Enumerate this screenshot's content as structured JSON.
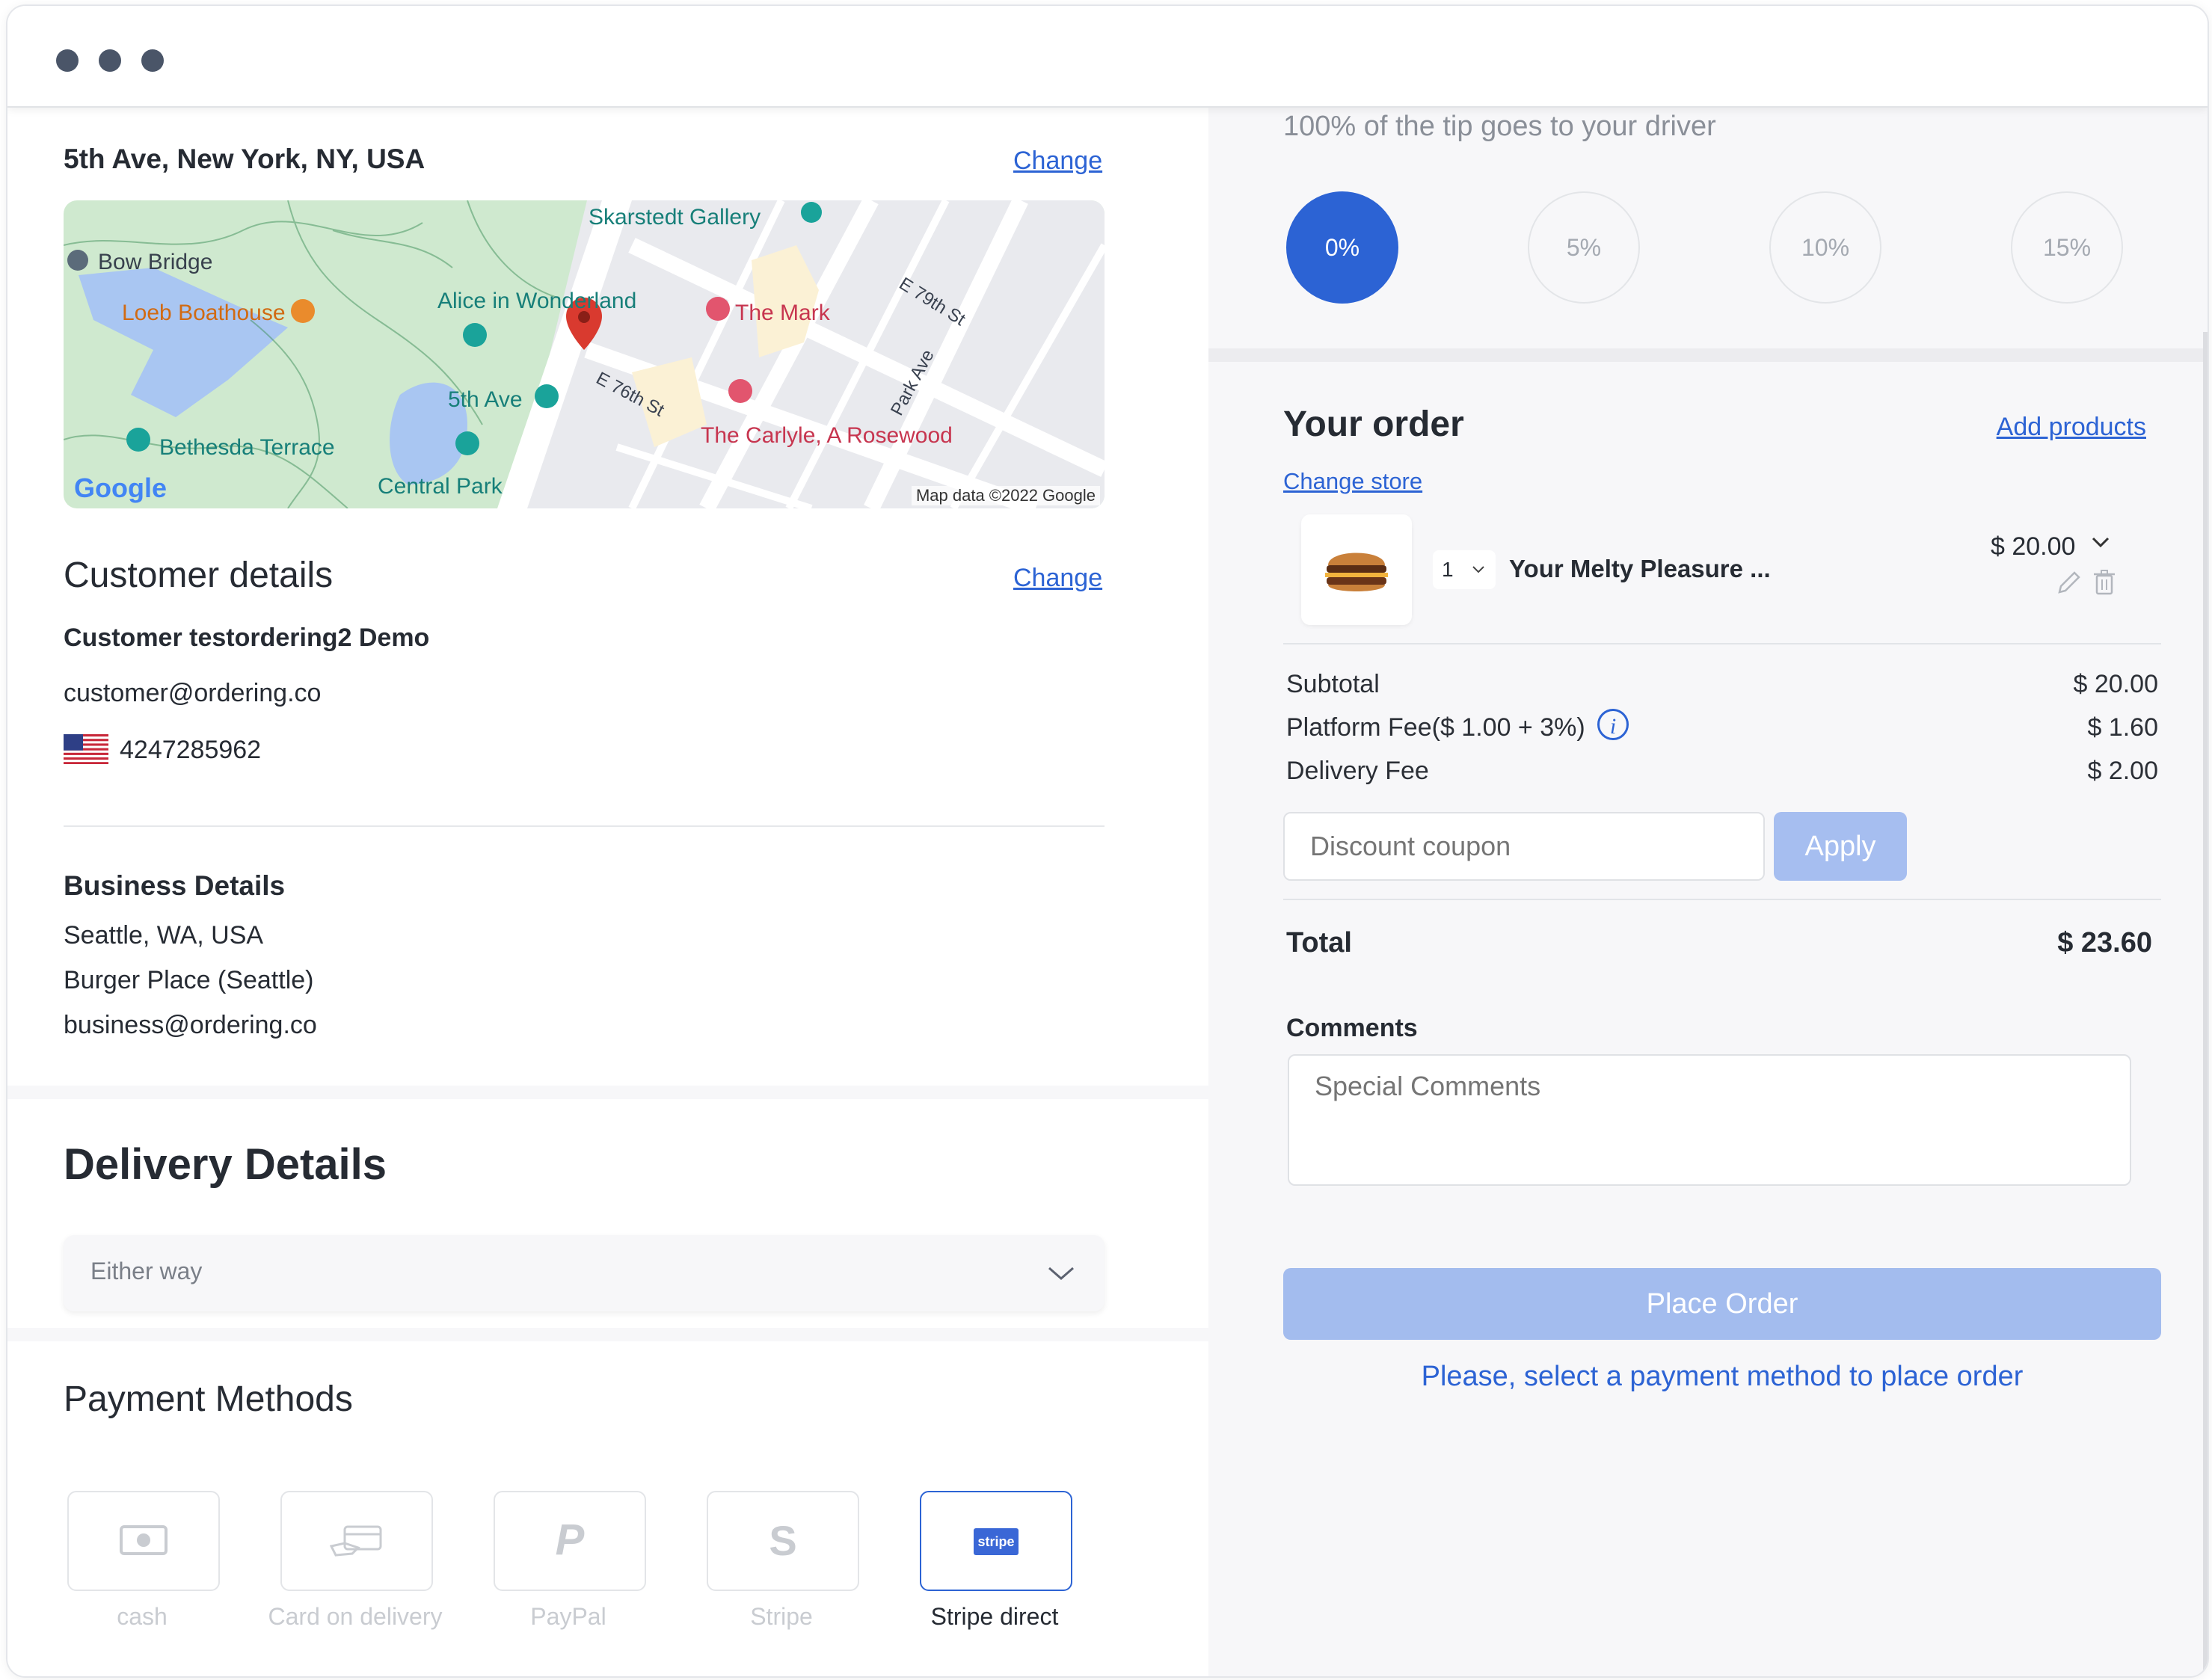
{
  "colors": {
    "accent": "#2c63d4",
    "tip_active": "#2c63d4",
    "apply_button": "#a6bef0",
    "place_order_button": "#a3bcee",
    "map_pin": "#d93a2f"
  },
  "address": {
    "title": "5th Ave, New York, NY, USA",
    "change_label": "Change"
  },
  "map": {
    "attribution": "Map data ©2022 Google",
    "logo": "Google",
    "labels": {
      "bow_bridge": "Bow Bridge",
      "loeb": "Loeb Boathouse",
      "alice": "Alice in Wonderland",
      "skarstedt": "Skarstedt Gallery",
      "the_mark": "The Mark",
      "e79": "E 79th St",
      "park_ave": "Park Ave",
      "e76": "E 76th St",
      "fifth_ave": "5th Ave",
      "bethesda": "Bethesda Terrace",
      "carlyle": "The Carlyle, A Rosewood",
      "central_park": "Central Park"
    }
  },
  "customer": {
    "heading": "Customer details",
    "change_label": "Change",
    "name": "Customer testordering2 Demo",
    "email": "customer@ordering.co",
    "phone": "4247285962"
  },
  "business": {
    "heading": "Business Details",
    "address": "Seattle, WA, USA",
    "name": "Burger Place (Seattle)",
    "email": "business@ordering.co"
  },
  "delivery": {
    "heading": "Delivery Details",
    "selected_option": "Either way"
  },
  "payment": {
    "heading": "Payment Methods",
    "methods": [
      {
        "label": "cash",
        "icon": "cash-icon"
      },
      {
        "label": "Card on delivery",
        "icon": "card-delivery-icon"
      },
      {
        "label": "PayPal",
        "icon": "paypal-icon"
      },
      {
        "label": "Stripe",
        "icon": "stripe-s-icon"
      },
      {
        "label": "Stripe direct",
        "icon": "stripe-logo-icon",
        "badge": "stripe"
      }
    ]
  },
  "tip": {
    "note": "100% of the tip goes to your driver",
    "options": [
      "0%",
      "5%",
      "10%",
      "15%"
    ],
    "selected": "0%"
  },
  "order": {
    "heading": "Your order",
    "add_products": "Add products",
    "change_store": "Change store",
    "item": {
      "quantity": "1",
      "name": "Your Melty Pleasure ...",
      "price": "$ 20.00"
    },
    "subtotal_label": "Subtotal",
    "subtotal": "$ 20.00",
    "platform_fee_label": "Platform Fee($ 1.00 + 3%)",
    "platform_fee": "$ 1.60",
    "delivery_fee_label": "Delivery Fee",
    "delivery_fee": "$ 2.00",
    "coupon_placeholder": "Discount coupon",
    "apply_label": "Apply",
    "total_label": "Total",
    "total": "$ 23.60",
    "comments_label": "Comments",
    "comments_placeholder": "Special Comments",
    "place_order_label": "Place Order",
    "payment_warning": "Please, select a payment method to place order"
  }
}
